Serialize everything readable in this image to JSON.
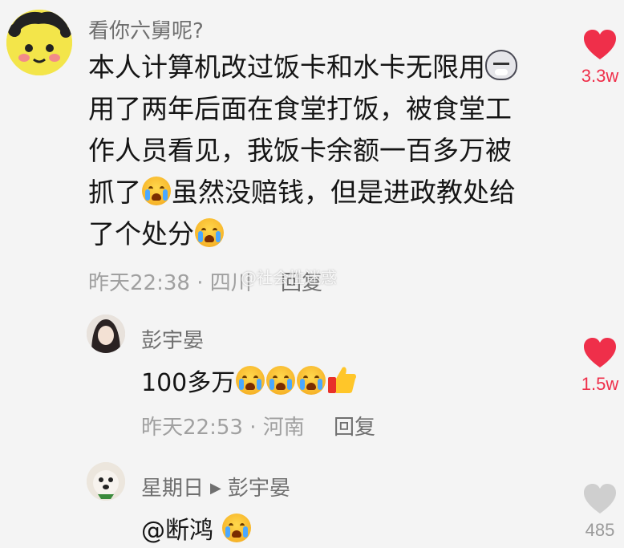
{
  "comment": {
    "username": "看你六舅呢?",
    "text_lines": [
      "本人计算机改过饭卡和水卡无限用",
      "用了两年后面在食堂打饭，被食堂工",
      "作人员看见，我饭卡余额一百多万被",
      "抓了",
      "虽然没赔钱，但是进政教处给",
      "了个处分"
    ],
    "meta_time": "昨天22:38",
    "meta_sep": "·",
    "meta_location": "四川",
    "reply_label": "回复",
    "likes": "3.3w",
    "liked": true
  },
  "watermark": "@社会性迷惑",
  "reply1": {
    "username": "彭宇晏",
    "text": "100多万",
    "meta_time": "昨天22:53",
    "meta_sep": "·",
    "meta_location": "河南",
    "reply_label": "回复",
    "likes": "1.5w",
    "liked": true
  },
  "reply2": {
    "username": "星期日",
    "target": "彭宇晏",
    "text": "@断鸿",
    "likes": "485",
    "liked": false
  },
  "colors": {
    "heart_active": "#ef2f4a",
    "heart_inactive": "#cfcfcf",
    "meta": "#a0a0a0",
    "username": "#6f6f6f"
  }
}
